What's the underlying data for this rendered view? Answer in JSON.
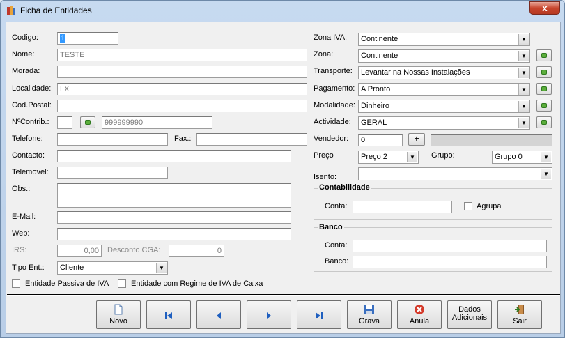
{
  "window": {
    "title": "Ficha de Entidades",
    "close": "x"
  },
  "left": {
    "codigo": {
      "label": "Codigo:",
      "value": "1"
    },
    "nome": {
      "label": "Nome:",
      "value": "TESTE"
    },
    "morada": {
      "label": "Morada:",
      "value": ""
    },
    "localidade": {
      "label": "Localidade:",
      "value": "LX"
    },
    "codpostal": {
      "label": "Cod.Postal:",
      "value": ""
    },
    "ncontrib": {
      "label": "NºContrib.:",
      "prefix": "",
      "value": "999999990"
    },
    "telefone": {
      "label": "Telefone:",
      "value": ""
    },
    "fax": {
      "label": "Fax.:",
      "value": ""
    },
    "contacto": {
      "label": "Contacto:",
      "value": ""
    },
    "telemovel": {
      "label": "Telemovel:",
      "value": ""
    },
    "obs": {
      "label": "Obs.:",
      "value": ""
    },
    "email": {
      "label": "E-Mail:",
      "value": ""
    },
    "web": {
      "label": "Web:",
      "value": ""
    },
    "irs": {
      "label": "IRS:",
      "value": "0,00"
    },
    "desconto": {
      "label": "Desconto CGA:",
      "value": "0"
    },
    "tipo_ent": {
      "label": "Tipo Ent.:",
      "value": "Cliente"
    },
    "passiva_iva": {
      "label": "Entidade Passiva de IVA",
      "checked": false
    },
    "regime_caixa": {
      "label": "Entidade com Regime de IVA de Caixa",
      "checked": false
    }
  },
  "right": {
    "zona_iva": {
      "label": "Zona IVA:",
      "value": "Continente"
    },
    "zona": {
      "label": "Zona:",
      "value": "Continente"
    },
    "transporte": {
      "label": "Transporte:",
      "value": "Levantar na Nossas Instalações"
    },
    "pagamento": {
      "label": "Pagamento:",
      "value": "A Pronto"
    },
    "modalidade": {
      "label": "Modalidade:",
      "value": "Dinheiro"
    },
    "actividade": {
      "label": "Actividade:",
      "value": "GERAL"
    },
    "vendedor": {
      "label": "Vendedor:",
      "value": "0",
      "add": "+"
    },
    "preco": {
      "label": "Preço",
      "value": "Preço 2"
    },
    "grupo": {
      "label": "Grupo:",
      "value": "Grupo 0"
    },
    "isento": {
      "label": "Isento:",
      "value": ""
    },
    "contabilidade": {
      "title": "Contabilidade",
      "conta_label": "Conta:",
      "conta_value": "",
      "agrupa": "Agrupa",
      "agrupa_checked": false
    },
    "banco": {
      "title": "Banco",
      "conta_label": "Conta:",
      "conta_value": "",
      "banco_label": "Banco:",
      "banco_value": ""
    }
  },
  "toolbar": {
    "novo": "Novo",
    "grava": "Grava",
    "anula": "Anula",
    "dados_line1": "Dados",
    "dados_line2": "Adicionais",
    "sair": "Sair"
  },
  "icons": {
    "first": "first-record-icon",
    "prev": "prev-record-icon",
    "next": "next-record-icon",
    "last": "last-record-icon",
    "accent_blue": "#1f5fbf",
    "accent_red": "#d43a2a",
    "accent_green": "#5cae3c"
  }
}
